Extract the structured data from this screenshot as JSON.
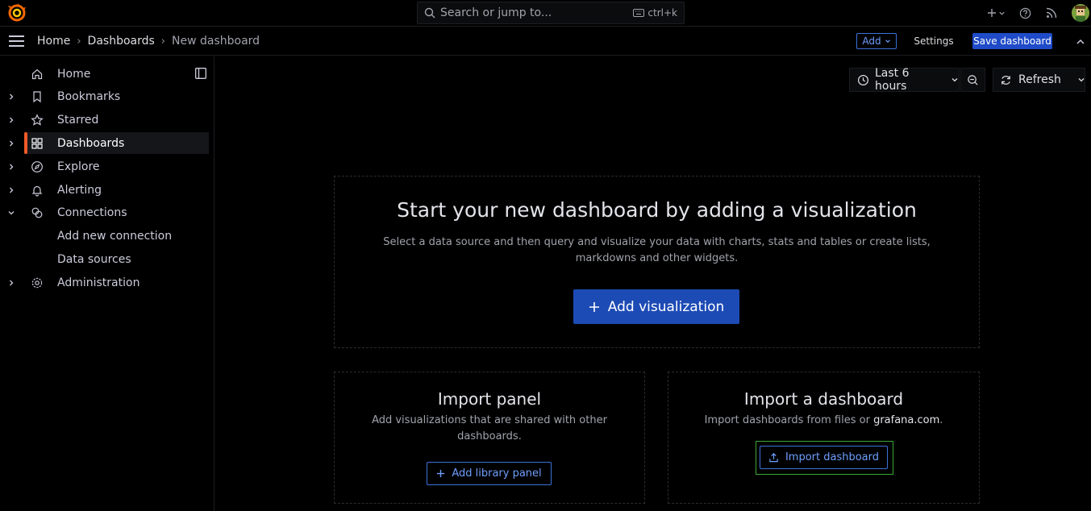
{
  "topbar": {
    "search_placeholder": "Search or jump to...",
    "search_shortcut": "ctrl+k",
    "icons": [
      "grafana-logo-icon",
      "search-icon",
      "keyboard-icon",
      "plus-icon",
      "chevron-down-icon",
      "help-icon",
      "rss-icon",
      "avatar"
    ]
  },
  "breadcrumb": {
    "items": [
      "Home",
      "Dashboards",
      "New dashboard"
    ]
  },
  "actions": {
    "add_label": "Add",
    "settings_label": "Settings",
    "save_label": "Save dashboard"
  },
  "sidebar": {
    "items": [
      {
        "label": "Home",
        "icon": "home-icon"
      },
      {
        "label": "Bookmarks",
        "icon": "bookmark-icon"
      },
      {
        "label": "Starred",
        "icon": "star-icon"
      },
      {
        "label": "Dashboards",
        "icon": "apps-icon",
        "active": true
      },
      {
        "label": "Explore",
        "icon": "compass-icon"
      },
      {
        "label": "Alerting",
        "icon": "bell-icon"
      },
      {
        "label": "Connections",
        "icon": "link-icon",
        "expanded": true
      },
      {
        "label": "Add new connection"
      },
      {
        "label": "Data sources"
      },
      {
        "label": "Administration",
        "icon": "cog-icon"
      }
    ]
  },
  "toolbar": {
    "time_range": "Last 6 hours",
    "refresh_label": "Refresh"
  },
  "empty_state": {
    "title": "Start your new dashboard by adding a visualization",
    "description": "Select a data source and then query and visualize your data with charts, stats and tables or create lists, markdowns and other widgets.",
    "description_line1": "Select a data source and then query and visualize your data with charts, stats and tables or create lists,",
    "description_line2": "markdowns and other widgets.",
    "button_label": "Add visualization"
  },
  "import_panel": {
    "title": "Import panel",
    "description_line1": "Add visualizations that are shared with other",
    "description_line2": "dashboards.",
    "button_label": "Add library panel"
  },
  "import_dashboard": {
    "title": "Import a dashboard",
    "description_prefix": "Import dashboards from files or ",
    "description_link": "grafana.com",
    "description_suffix": ".",
    "button_label": "Import dashboard"
  },
  "colors": {
    "accent": "#f05a28",
    "primary": "#1d4bb5",
    "link": "#6e9fff",
    "highlight": "#3aa835"
  }
}
